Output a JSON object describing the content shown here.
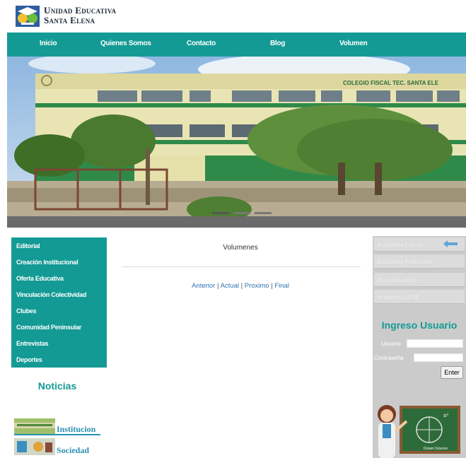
{
  "header": {
    "logo_line1": "Unidad Educativa",
    "logo_line2": "Santa Elena",
    "logo_icon": "school-logo-icon"
  },
  "nav": [
    {
      "label": "Inicio"
    },
    {
      "label": "Quienes Somos"
    },
    {
      "label": "Contacto"
    },
    {
      "label": "Blog"
    },
    {
      "label": "Volumen"
    }
  ],
  "banner": {
    "building_sign": "COLEGIO FISCAL TEC. SANTA ELE"
  },
  "left_menu": [
    {
      "label": "Editorial"
    },
    {
      "label": "Creación Institucional"
    },
    {
      "label": "Oferta Educativa"
    },
    {
      "label": "Vinculación Colectividad"
    },
    {
      "label": "Clubes"
    },
    {
      "label": "Comunidad Peninsular"
    },
    {
      "label": "Entrevistas"
    },
    {
      "label": "Deportes"
    }
  ],
  "news": {
    "title": "Noticias",
    "items": [
      {
        "label": "Institucion"
      },
      {
        "label": "Sociedad"
      }
    ]
  },
  "main": {
    "title": "Volumenes",
    "pager": {
      "prev": "Anterior",
      "current": "Actual",
      "next": "Proximo",
      "last": "Final"
    }
  },
  "right": {
    "buttons": [
      {
        "label": "Busqueda Edición"
      },
      {
        "label": "Busqueda Publicación"
      },
      {
        "label": "Busqueda Autor"
      },
      {
        "label": "Imagenes UESE"
      }
    ],
    "login_title": "Ingreso Usuario",
    "user_label": "Usuario",
    "pass_label": "Contraseña",
    "user_value": "",
    "pass_value": "",
    "enter_label": "Enter",
    "chalkboard_caption": "Dream Science"
  },
  "colors": {
    "teal": "#139a94",
    "link": "#2f73b5",
    "sidebar_gray": "#cbcbcb"
  }
}
